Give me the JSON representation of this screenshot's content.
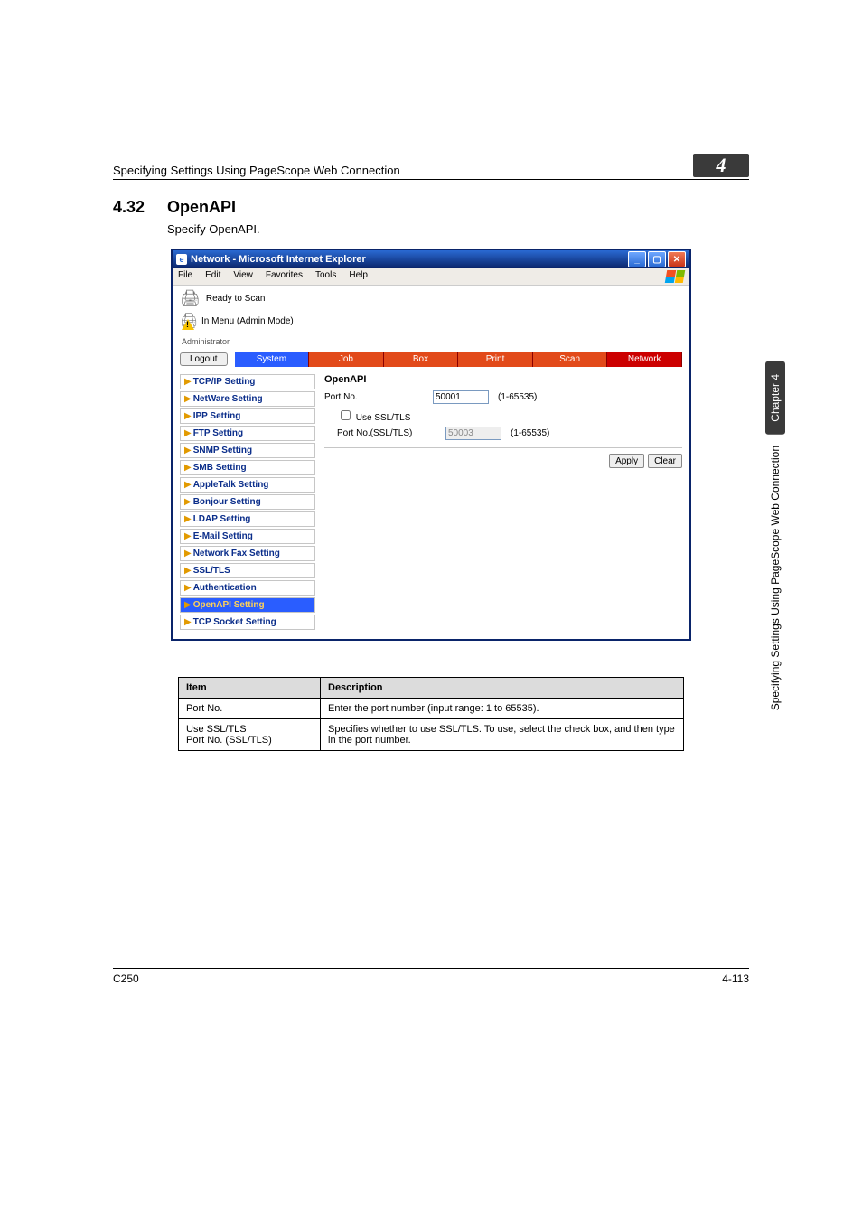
{
  "header": {
    "title": "Specifying Settings Using PageScope Web Connection",
    "badge": "4"
  },
  "section": {
    "number": "4.32",
    "title": "OpenAPI",
    "body": "Specify OpenAPI."
  },
  "screenshot": {
    "window_title": "Network - Microsoft Internet Explorer",
    "menus": [
      "File",
      "Edit",
      "View",
      "Favorites",
      "Tools",
      "Help"
    ],
    "status": {
      "line1": "Ready to Scan",
      "line2": "In Menu (Admin Mode)"
    },
    "admin_label": "Administrator",
    "logout": "Logout",
    "tabs": {
      "system": "System",
      "job": "Job",
      "box": "Box",
      "print": "Print",
      "scan": "Scan",
      "network": "Network"
    },
    "sidebar": [
      "TCP/IP Setting",
      "NetWare Setting",
      "IPP Setting",
      "FTP Setting",
      "SNMP Setting",
      "SMB Setting",
      "AppleTalk Setting",
      "Bonjour Setting",
      "LDAP Setting",
      "E-Mail Setting",
      "Network Fax Setting",
      "SSL/TLS",
      "Authentication",
      "OpenAPI Setting",
      "TCP Socket Setting"
    ],
    "sidebar_active_index": 13,
    "panel": {
      "heading": "OpenAPI",
      "port_label": "Port No.",
      "port_value": "50001",
      "port_range": "(1-65535)",
      "use_ssl_label": "Use SSL/TLS",
      "ssl_port_label": "Port No.(SSL/TLS)",
      "ssl_port_value": "50003",
      "ssl_port_range": "(1-65535)",
      "apply": "Apply",
      "clear": "Clear"
    }
  },
  "desc_table": {
    "head_item": "Item",
    "head_desc": "Description",
    "rows": [
      {
        "item": "Port No.",
        "desc": "Enter the port number (input range: 1 to 65535)."
      },
      {
        "item": "Use SSL/TLS\nPort No. (SSL/TLS)",
        "desc": "Specifies whether to use SSL/TLS. To use, select the check box, and then type in the port number."
      }
    ]
  },
  "side_label": {
    "chapter": "Chapter 4",
    "text": "Specifying Settings Using PageScope Web Connection"
  },
  "footer": {
    "left": "C250",
    "right": "4-113"
  }
}
